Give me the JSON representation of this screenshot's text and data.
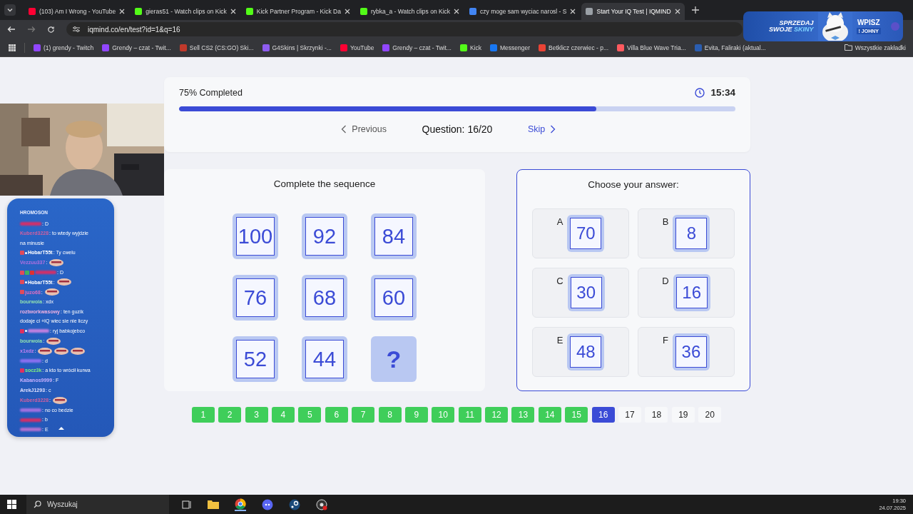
{
  "browser": {
    "tabs": [
      {
        "title": "(103) Am I Wrong - YouTube",
        "kind": "youtube",
        "selected": false
      },
      {
        "title": "gieras51 - Watch clips on Kick",
        "kind": "kick",
        "selected": false
      },
      {
        "title": "Kick Partner Program - Kick Da",
        "kind": "kick",
        "selected": false
      },
      {
        "title": "rybka_a - Watch clips on Kick",
        "kind": "kick",
        "selected": false
      },
      {
        "title": "czy moge sam wyciac narosl - S",
        "kind": "google",
        "selected": false
      },
      {
        "title": "Start Your IQ Test | IQMIND",
        "kind": "globe",
        "selected": true
      }
    ],
    "address": "iqmind.co/en/test?id=1&q=16",
    "bookmarks": [
      {
        "label": "(1) grendy - Twitch",
        "kind": "twitch"
      },
      {
        "label": "Grendy – czat - Twit...",
        "kind": "twitch"
      },
      {
        "label": "Sell CS2 (CS:GO) Ski...",
        "kind": "skins"
      },
      {
        "label": "G4Skins | Skrzynki -...",
        "kind": "gem"
      },
      {
        "label": "YouTube",
        "kind": "youtube"
      },
      {
        "label": "Grendy – czat - Twit...",
        "kind": "twitch"
      },
      {
        "label": "Kick",
        "kind": "kick"
      },
      {
        "label": "Messenger",
        "kind": "facebook"
      },
      {
        "label": "Betklicz czerwiec - p...",
        "kind": "mail"
      },
      {
        "label": "Villa Blue Wave Tria...",
        "kind": "airbnb"
      },
      {
        "label": "Evita, Faliraki (aktual...",
        "kind": "booking"
      }
    ],
    "all_bookmarks": "Wszystkie zakładki"
  },
  "banner": {
    "line_1": "SPRZEDAJ",
    "line_2": "SWOJE",
    "line_2_accent": "SKINY",
    "cta": "WPISZ",
    "code": "! JOHNY"
  },
  "test": {
    "progress_label": "75% Completed",
    "level": 0.75,
    "timer": "15:34",
    "previous": "Previous",
    "question": "Question: 16/20",
    "skip": "Skip",
    "sequence_title": "Complete the sequence",
    "sequence": [
      {
        "kind": "number",
        "text": "100"
      },
      {
        "kind": "number",
        "text": "92"
      },
      {
        "kind": "number",
        "text": "84"
      },
      {
        "kind": "number",
        "text": "76"
      },
      {
        "kind": "number",
        "text": "68"
      },
      {
        "kind": "number",
        "text": "60"
      },
      {
        "kind": "number",
        "text": "52"
      },
      {
        "kind": "number",
        "text": "44"
      },
      {
        "kind": "unknown",
        "text": "?"
      }
    ],
    "answers_title": "Choose your answer:",
    "answers": [
      {
        "letter": "A",
        "value": "70"
      },
      {
        "letter": "B",
        "value": "8"
      },
      {
        "letter": "C",
        "value": "30"
      },
      {
        "letter": "D",
        "value": "16"
      },
      {
        "letter": "E",
        "value": "48"
      },
      {
        "letter": "F",
        "value": "36"
      }
    ],
    "pages": [
      {
        "label": "1",
        "completed": true,
        "selected": false
      },
      {
        "label": "2",
        "completed": true,
        "selected": false
      },
      {
        "label": "3",
        "completed": true,
        "selected": false
      },
      {
        "label": "4",
        "completed": true,
        "selected": false
      },
      {
        "label": "5",
        "completed": true,
        "selected": false
      },
      {
        "label": "6",
        "completed": true,
        "selected": false
      },
      {
        "label": "7",
        "completed": true,
        "selected": false
      },
      {
        "label": "8",
        "completed": true,
        "selected": false
      },
      {
        "label": "9",
        "completed": true,
        "selected": false
      },
      {
        "label": "10",
        "completed": true,
        "selected": false
      },
      {
        "label": "11",
        "completed": true,
        "selected": false
      },
      {
        "label": "12",
        "completed": true,
        "selected": false
      },
      {
        "label": "13",
        "completed": true,
        "selected": false
      },
      {
        "label": "14",
        "completed": true,
        "selected": false
      },
      {
        "label": "15",
        "completed": true,
        "selected": false
      },
      {
        "label": "16",
        "completed": false,
        "selected": true
      },
      {
        "label": "17",
        "completed": false,
        "selected": false
      },
      {
        "label": "18",
        "completed": false,
        "selected": false
      },
      {
        "label": "19",
        "completed": false,
        "selected": false
      },
      {
        "label": "20",
        "completed": false,
        "selected": false
      }
    ]
  },
  "chat": {
    "header": "HROMOSON",
    "messages": [
      {
        "parts": [
          {
            "kind": "blur",
            "color": "#d0306a"
          },
          {
            "kind": "text",
            "text": ": D"
          }
        ]
      },
      {
        "parts": [
          {
            "kind": "user",
            "text": "Kuberd3228",
            "color": "#d060a0"
          },
          {
            "kind": "text",
            "text": ": to wtedy wyjdzie"
          },
          {
            "kind": "line",
            "text": "na minusie"
          }
        ]
      },
      {
        "parts": [
          {
            "kind": "badge",
            "color": "#e04a5a"
          },
          {
            "kind": "dot"
          },
          {
            "kind": "user",
            "text": "HobarT55t",
            "color": "#ffffff"
          },
          {
            "kind": "text",
            "text": ": Ty cwelu"
          }
        ]
      },
      {
        "parts": [
          {
            "kind": "user",
            "text": "Vezzuu337",
            "color": "#b070e0"
          },
          {
            "kind": "text",
            "text": ":"
          },
          {
            "kind": "emote"
          }
        ]
      },
      {
        "parts": [
          {
            "kind": "badge",
            "color": "#e04a5a"
          },
          {
            "kind": "badge",
            "color": "#40b060"
          },
          {
            "kind": "badge",
            "color": "#e03030"
          },
          {
            "kind": "blur",
            "color": "#d0306a"
          },
          {
            "kind": "text",
            "text": ": D"
          }
        ]
      },
      {
        "parts": [
          {
            "kind": "badge",
            "color": "#e04a5a"
          },
          {
            "kind": "dot"
          },
          {
            "kind": "user",
            "text": "HobarT55t",
            "color": "#ffffff"
          },
          {
            "kind": "text",
            "text": ":"
          },
          {
            "kind": "emote"
          }
        ]
      },
      {
        "parts": [
          {
            "kind": "badge",
            "color": "#e04a5a"
          },
          {
            "kind": "user",
            "text": "juzo68",
            "color": "#e070c0"
          },
          {
            "kind": "text",
            "text": ":"
          },
          {
            "kind": "emote"
          }
        ]
      },
      {
        "parts": [
          {
            "kind": "user",
            "text": "bourwoia",
            "color": "#90e0b0"
          },
          {
            "kind": "text",
            "text": ": xdx"
          }
        ]
      },
      {
        "parts": [
          {
            "kind": "user",
            "text": "roztworkwasowy",
            "color": "#f0b0e0"
          },
          {
            "kind": "text",
            "text": ": ten guzik"
          },
          {
            "kind": "line",
            "text": "dodaje ci +IQ wiec sie nie liczy"
          }
        ]
      },
      {
        "parts": [
          {
            "kind": "badge",
            "color": "#e03060"
          },
          {
            "kind": "dot"
          },
          {
            "kind": "blur",
            "color": "#c080e0"
          },
          {
            "kind": "text",
            "text": ": ryj babkojebco"
          }
        ]
      },
      {
        "parts": [
          {
            "kind": "user",
            "text": "bourwoia",
            "color": "#90e0b0"
          },
          {
            "kind": "text",
            "text": ":"
          },
          {
            "kind": "emote"
          }
        ]
      },
      {
        "parts": [
          {
            "kind": "user",
            "text": "x1xdz",
            "color": "#c080f0"
          },
          {
            "kind": "text",
            "text": ":"
          },
          {
            "kind": "emote"
          },
          {
            "kind": "emote"
          },
          {
            "kind": "emote"
          }
        ]
      },
      {
        "parts": [
          {
            "kind": "blur",
            "color": "#8a70f0"
          },
          {
            "kind": "text",
            "text": ": d"
          }
        ]
      },
      {
        "parts": [
          {
            "kind": "badge",
            "color": "#e03060"
          },
          {
            "kind": "user",
            "text": "socz3k",
            "color": "#80f080"
          },
          {
            "kind": "text",
            "text": ": a kto to wrócił kurwa"
          }
        ]
      },
      {
        "parts": [
          {
            "kind": "user",
            "text": "Kabanos9999",
            "color": "#c8b0ff"
          },
          {
            "kind": "text",
            "text": ": F"
          }
        ]
      },
      {
        "parts": [
          {
            "kind": "user",
            "text": "ArekJ1293",
            "color": "#e0e0ff"
          },
          {
            "kind": "text",
            "text": ": c"
          }
        ]
      },
      {
        "parts": [
          {
            "kind": "user",
            "text": "Kuberd3228",
            "color": "#d060a0"
          },
          {
            "kind": "text",
            "text": ":"
          },
          {
            "kind": "emote"
          }
        ]
      },
      {
        "parts": [
          {
            "kind": "blur",
            "color": "#a070e0"
          },
          {
            "kind": "text",
            "text": ": no co bedzie"
          }
        ]
      },
      {
        "parts": [
          {
            "kind": "blur",
            "color": "#d0306a"
          },
          {
            "kind": "text",
            "text": ": b"
          }
        ]
      },
      {
        "parts": [
          {
            "kind": "blur",
            "color": "#b070d0"
          },
          {
            "kind": "text",
            "text": ": E"
          }
        ]
      }
    ]
  },
  "taskbar": {
    "search_placeholder": "Wyszukaj",
    "time": "19:30",
    "date": "24.07.2025"
  }
}
